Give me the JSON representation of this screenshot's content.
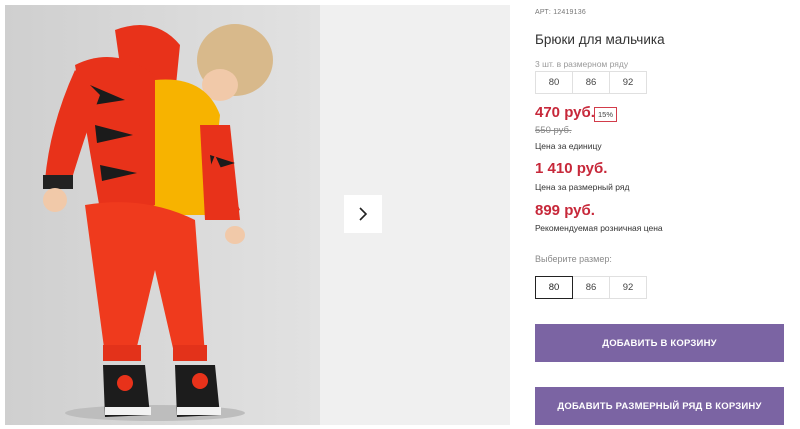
{
  "product": {
    "article": "АРТ: 12419136",
    "title": "Брюки для мальчика",
    "photo_icon": "product-photo"
  },
  "size_range": {
    "label": "3 шт. в размерном ряду",
    "sizes": [
      "80",
      "86",
      "92"
    ]
  },
  "prices": {
    "unit_price": "470 руб.",
    "discount": "15%",
    "old_price": "550 руб.",
    "unit_caption": "Цена за единицу",
    "range_price": "1 410 руб.",
    "range_caption": "Цена за размерный ряд",
    "retail_price": "899 руб.",
    "retail_caption": "Рекомендуемая розничная цена"
  },
  "size_select": {
    "label": "Выберите размер:",
    "options": [
      "80",
      "86",
      "92"
    ],
    "selected": "80"
  },
  "actions": {
    "add_to_cart": "ДОБАВИТЬ В КОРЗИНУ",
    "add_range_to_cart": "ДОБАВИТЬ РАЗМЕРНЫЙ РЯД В КОРЗИНУ"
  },
  "colors": {
    "accent_button": "#7b64a3",
    "price_red": "#c7283a"
  }
}
